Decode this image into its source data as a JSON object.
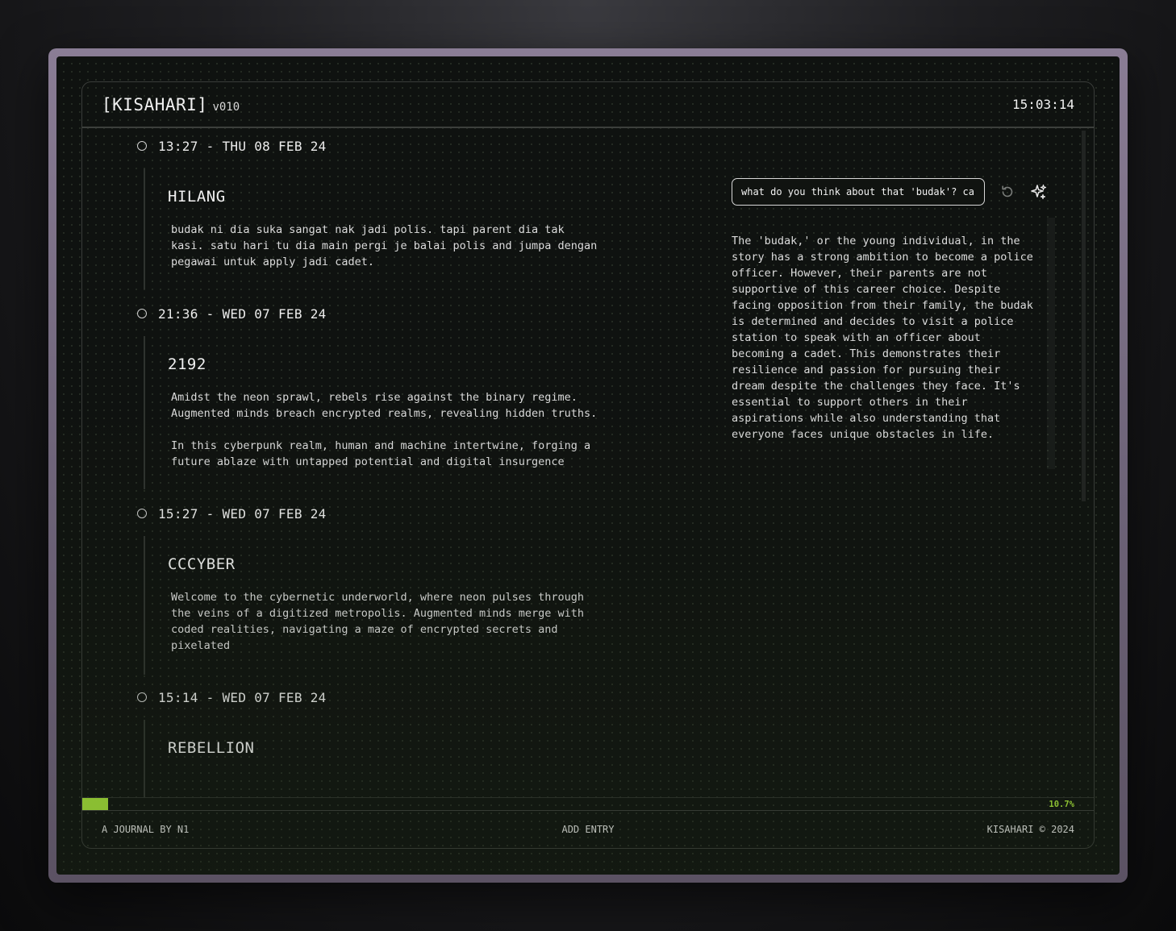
{
  "header": {
    "brand": "[KISAHARI]",
    "version": "v010",
    "clock": "15:03:14"
  },
  "entries": [
    {
      "date": "13:27 - THU 08 FEB 24",
      "title": "HILANG",
      "text": "budak ni dia suka sangat nak jadi polis. tapi parent dia tak\nkasi. satu hari tu dia main pergi je balai polis and jumpa dengan\npegawai untuk apply jadi cadet."
    },
    {
      "date": "21:36 - WED 07 FEB 24",
      "title": "2192",
      "text": "Amidst the neon sprawl, rebels rise against the binary regime.\nAugmented minds breach encrypted realms, revealing hidden truths.\n\nIn this cyberpunk realm, human and machine intertwine, forging a\nfuture ablaze with untapped potential and digital insurgence"
    },
    {
      "date": "15:27 - WED 07 FEB 24",
      "title": "CCCYBER",
      "text": "Welcome to the cybernetic underworld, where neon pulses through\nthe veins of a digitized metropolis. Augmented minds merge with\ncoded realities, navigating a maze of encrypted secrets and\npixelated"
    },
    {
      "date": "15:14 - WED 07 FEB 24",
      "title": "REBELLION",
      "text": ""
    }
  ],
  "ai": {
    "prompt_value": "what do you think about that 'budak'? ca",
    "response": "The 'budak,' or the young individual, in the story has a strong ambition to become a police officer. However, their parents are not supportive of this career choice. Despite facing opposition from their family, the budak is determined and decides to visit a police station to speak with an officer about becoming a cadet. This demonstrates their resilience and passion for pursuing their dream despite the challenges they face. It's essential to support others in their aspirations while also understanding that everyone faces unique obstacles in life.",
    "reset_icon": "refresh-icon",
    "sparkle_icon": "sparkle-icon"
  },
  "progress": {
    "value": 0.107,
    "label": "10.7%"
  },
  "footer": {
    "left": "A JOURNAL BY N1",
    "center": "ADD ENTRY",
    "right": "KISAHARI © 2024"
  },
  "colors": {
    "accent": "#a8e63a",
    "background": "#0f1210",
    "text": "#e8e8e8"
  }
}
